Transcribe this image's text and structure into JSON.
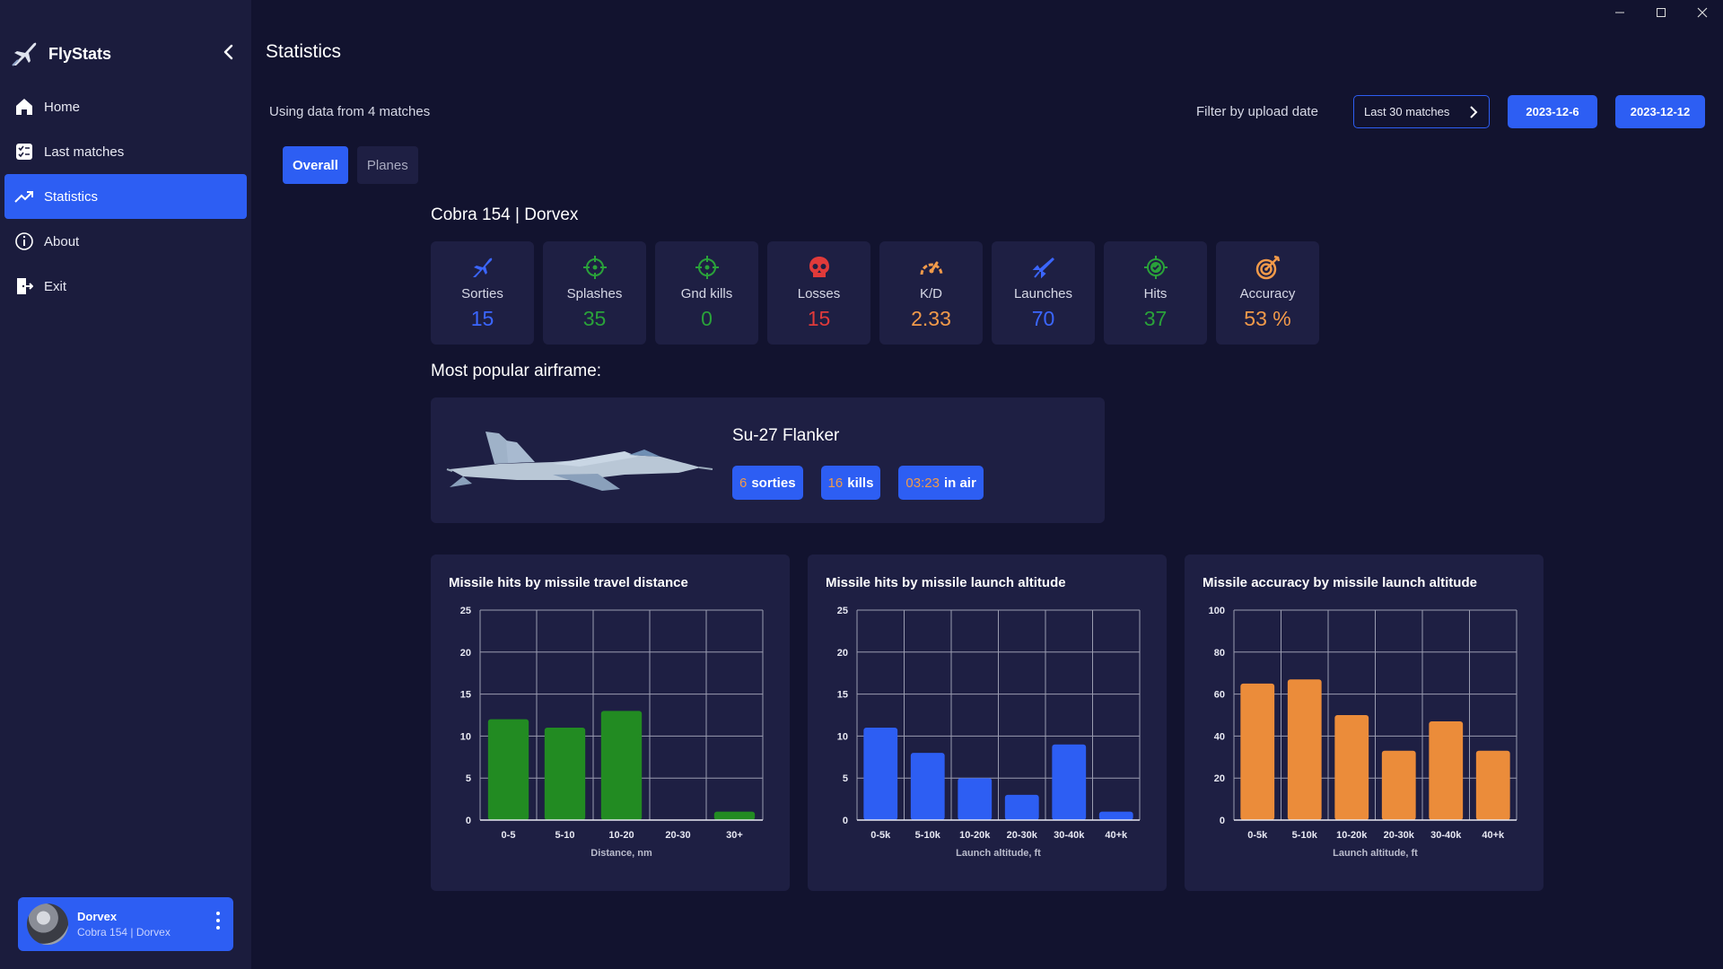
{
  "app": {
    "name": "FlyStats"
  },
  "sidebar": {
    "items": [
      {
        "label": "Home",
        "icon": "home-icon"
      },
      {
        "label": "Last matches",
        "icon": "list-icon"
      },
      {
        "label": "Statistics",
        "icon": "trending-icon",
        "active": true
      },
      {
        "label": "About",
        "icon": "info-icon"
      },
      {
        "label": "Exit",
        "icon": "exit-icon"
      }
    ],
    "profile": {
      "name": "Dorvex",
      "subtitle": "Cobra 154 | Dorvex"
    }
  },
  "header": {
    "title": "Statistics",
    "using_data": "Using data from 4 matches",
    "filter_label": "Filter by upload date",
    "last_matches_btn": "Last 30 matches",
    "date_from": "2023-12-6",
    "date_to": "2023-12-12"
  },
  "tabs": [
    {
      "label": "Overall",
      "active": true
    },
    {
      "label": "Planes",
      "active": false
    }
  ],
  "pilot": "Cobra 154 | Dorvex",
  "stats": [
    {
      "label": "Sorties",
      "value": "15",
      "color": "#3b66ff",
      "icon": "jet-icon"
    },
    {
      "label": "Splashes",
      "value": "35",
      "color": "#2aa23a",
      "icon": "crosshair-icon"
    },
    {
      "label": "Gnd kills",
      "value": "0",
      "color": "#2aa23a",
      "icon": "crosshair-icon"
    },
    {
      "label": "Losses",
      "value": "15",
      "color": "#e03a3a",
      "icon": "skull-icon"
    },
    {
      "label": "K/D",
      "value": "2.33",
      "color": "#f29a4a",
      "icon": "gauge-icon"
    },
    {
      "label": "Launches",
      "value": "70",
      "color": "#3b66ff",
      "icon": "missile-icon"
    },
    {
      "label": "Hits",
      "value": "37",
      "color": "#2aa23a",
      "icon": "check-target-icon"
    },
    {
      "label": "Accuracy",
      "value": "53 %",
      "color": "#f29a4a",
      "icon": "bullseye-icon"
    }
  ],
  "popular": {
    "title": "Most popular airframe:",
    "plane": "Su-27 Flanker",
    "sorties_num": "6",
    "sorties_label": "sorties",
    "kills_num": "16",
    "kills_label": "kills",
    "air_num": "03:23",
    "air_label": "in air"
  },
  "chart_data": [
    {
      "type": "bar",
      "title": "Missile hits by missile travel distance",
      "categories": [
        "0-5",
        "5-10",
        "10-20",
        "20-30",
        "30+"
      ],
      "values": [
        12,
        11,
        13,
        0,
        1
      ],
      "xlabel": "Distance, nm",
      "ylabel": "",
      "ylim": [
        0,
        25
      ],
      "yticks": [
        0,
        5,
        10,
        15,
        20,
        25
      ],
      "color": "#228b22",
      "grid": true
    },
    {
      "type": "bar",
      "title": "Missile hits by missile launch altitude",
      "categories": [
        "0-5k",
        "5-10k",
        "10-20k",
        "20-30k",
        "30-40k",
        "40+k"
      ],
      "values": [
        11,
        8,
        5,
        3,
        9,
        1
      ],
      "xlabel": "Launch altitude, ft",
      "ylabel": "",
      "ylim": [
        0,
        25
      ],
      "yticks": [
        0,
        5,
        10,
        15,
        20,
        25
      ],
      "color": "#2d5ef3",
      "grid": true
    },
    {
      "type": "bar",
      "title": "Missile accuracy by missile launch altitude",
      "categories": [
        "0-5k",
        "5-10k",
        "10-20k",
        "20-30k",
        "30-40k",
        "40+k"
      ],
      "values": [
        65,
        67,
        50,
        33,
        47,
        33
      ],
      "xlabel": "Launch altitude, ft",
      "ylabel": "",
      "ylim": [
        0,
        100
      ],
      "yticks": [
        0,
        20,
        40,
        60,
        80,
        100
      ],
      "color": "#eb8c3a",
      "grid": true
    }
  ]
}
